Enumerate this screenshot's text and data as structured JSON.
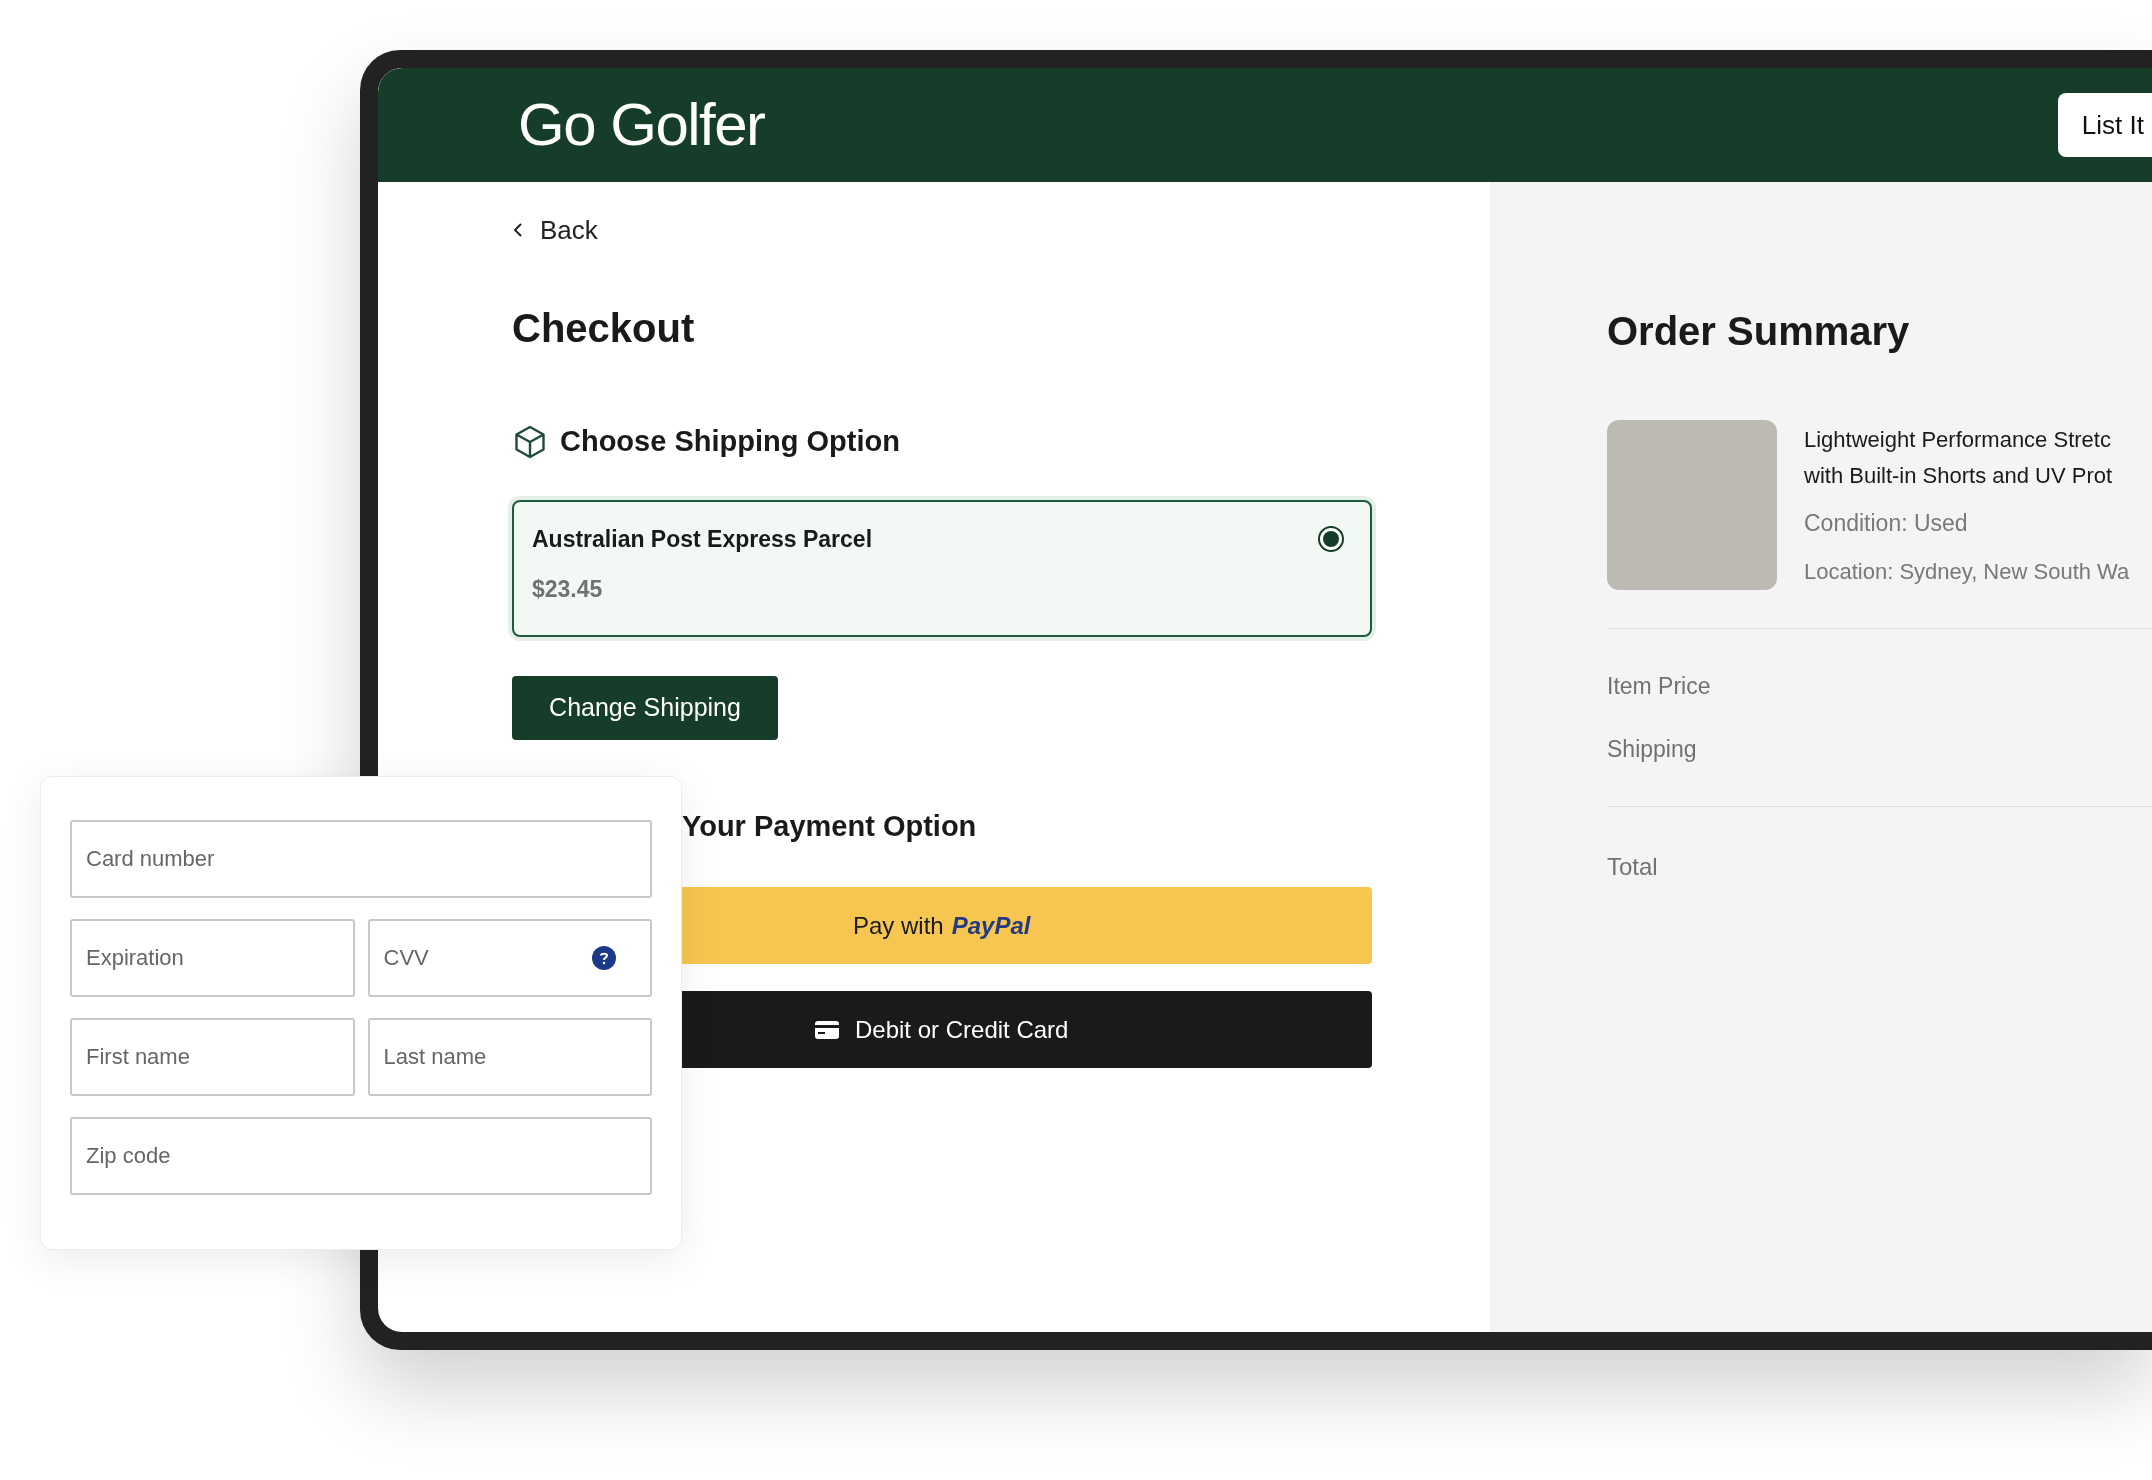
{
  "header": {
    "logo": "Go Golfer",
    "button": "List It"
  },
  "back_link": "Back",
  "title": "Checkout",
  "shipping": {
    "heading": "Choose Shipping Option",
    "options": [
      {
        "name": "Australian Post Express Parcel",
        "price": "$23.45",
        "selected": true
      }
    ],
    "change_button": "Change Shipping"
  },
  "payment": {
    "heading": "Your Payment Option",
    "buttons": [
      {
        "kind": "paypal",
        "label": "Pay with",
        "logo": "PayPal"
      },
      {
        "kind": "card",
        "label": "Debit or Credit Card"
      }
    ]
  },
  "card_form": {
    "rows": [
      [
        {
          "placeholder": "Card number",
          "help": false
        }
      ],
      [
        {
          "placeholder": "Expiration",
          "help": false
        },
        {
          "placeholder": "CVV",
          "help": true
        }
      ],
      [
        {
          "placeholder": "First name",
          "help": false
        },
        {
          "placeholder": "Last name",
          "help": false
        }
      ],
      [
        {
          "placeholder": "Zip code",
          "help": false
        }
      ]
    ]
  },
  "order_summary": {
    "title": "Order Summary",
    "item": {
      "name_lines": [
        "Lightweight Performance Stretc",
        "with Built-in Shorts and UV Prot"
      ],
      "condition": "Condition: Used",
      "location": "Location: Sydney, New South Wa"
    },
    "price_rows": [
      "Item Price",
      "Shipping"
    ],
    "total_label": "Total"
  }
}
